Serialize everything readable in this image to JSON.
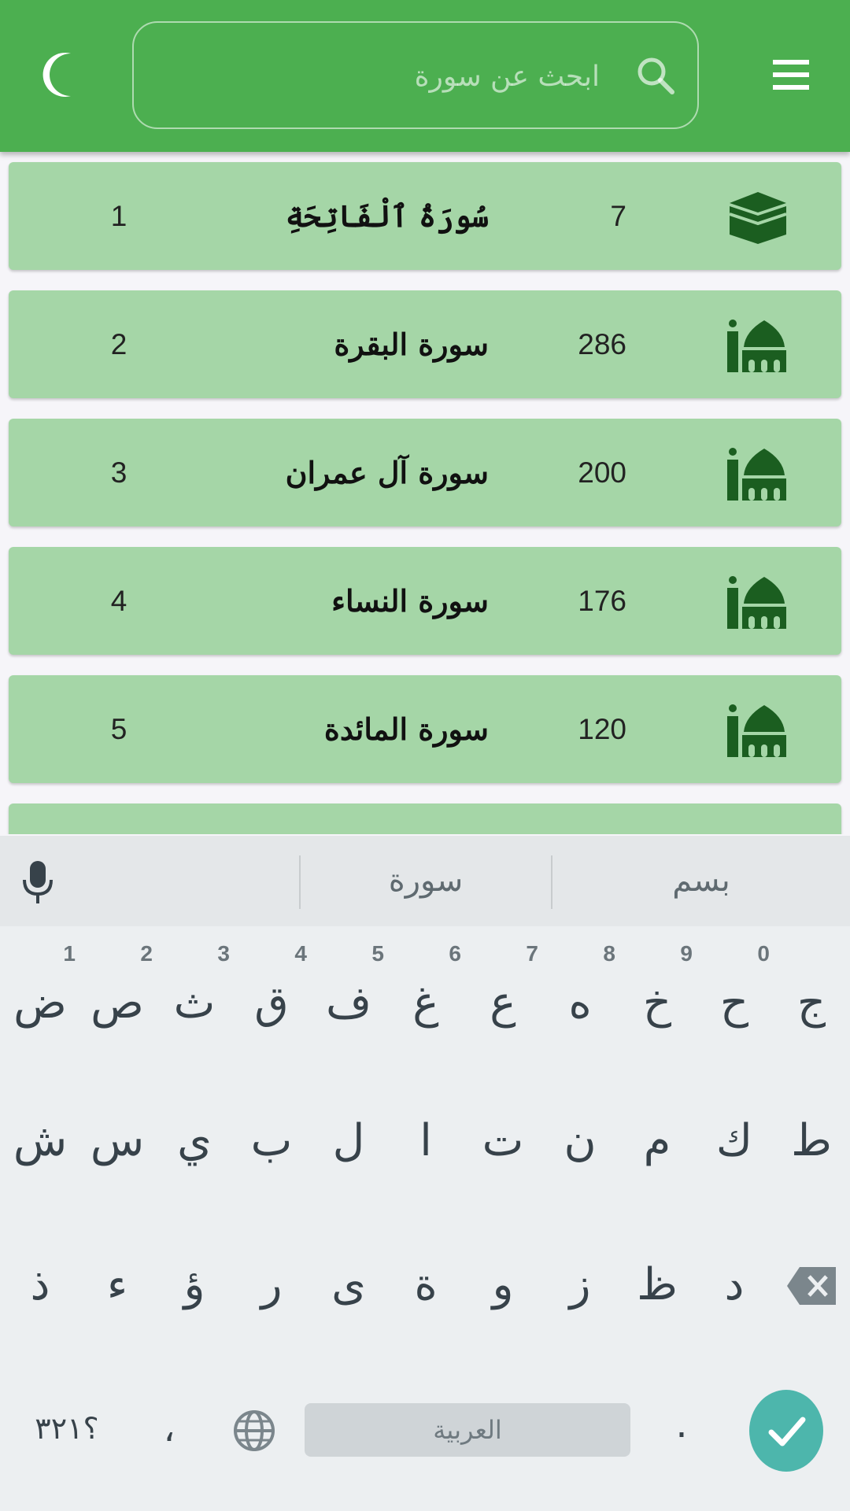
{
  "header": {
    "search_placeholder": "ابحث عن سورة",
    "theme_icon": "crescent-moon-icon",
    "menu_icon": "hamburger-menu-icon",
    "search_icon": "search-icon",
    "accent_color": "#4caf50"
  },
  "surahs": [
    {
      "number": "1",
      "name": "سُورَةُ ٱلْفَاتِحَةِ",
      "ayat": "7",
      "place_icon": "kaaba-icon"
    },
    {
      "number": "2",
      "name": "سورة البقرة",
      "ayat": "286",
      "place_icon": "mosque-icon"
    },
    {
      "number": "3",
      "name": "سورة آل عمران",
      "ayat": "200",
      "place_icon": "mosque-icon"
    },
    {
      "number": "4",
      "name": "سورة النساء",
      "ayat": "176",
      "place_icon": "mosque-icon"
    },
    {
      "number": "5",
      "name": "سورة المائدة",
      "ayat": "120",
      "place_icon": "mosque-icon"
    }
  ],
  "keyboard": {
    "suggestions": [
      "بسم",
      "سورة"
    ],
    "row1": [
      {
        "k": "ج",
        "h": ""
      },
      {
        "k": "ح",
        "h": "0"
      },
      {
        "k": "خ",
        "h": "9"
      },
      {
        "k": "ه",
        "h": "8"
      },
      {
        "k": "ع",
        "h": "7"
      },
      {
        "k": "غ",
        "h": "6"
      },
      {
        "k": "ف",
        "h": "5"
      },
      {
        "k": "ق",
        "h": "4"
      },
      {
        "k": "ث",
        "h": "3"
      },
      {
        "k": "ص",
        "h": "2"
      },
      {
        "k": "ض",
        "h": "1"
      }
    ],
    "row2": [
      "ط",
      "ك",
      "م",
      "ن",
      "ت",
      "ا",
      "ل",
      "ب",
      "ي",
      "س",
      "ش"
    ],
    "row3": [
      "د",
      "ظ",
      "ز",
      "و",
      "ة",
      "ى",
      "ر",
      "ؤ",
      "ء",
      "ذ"
    ],
    "symbols_label": "؟٣٢١",
    "comma_label": "،",
    "space_label": "العربية",
    "period_label": ".",
    "enter_color": "#4db6ac"
  }
}
